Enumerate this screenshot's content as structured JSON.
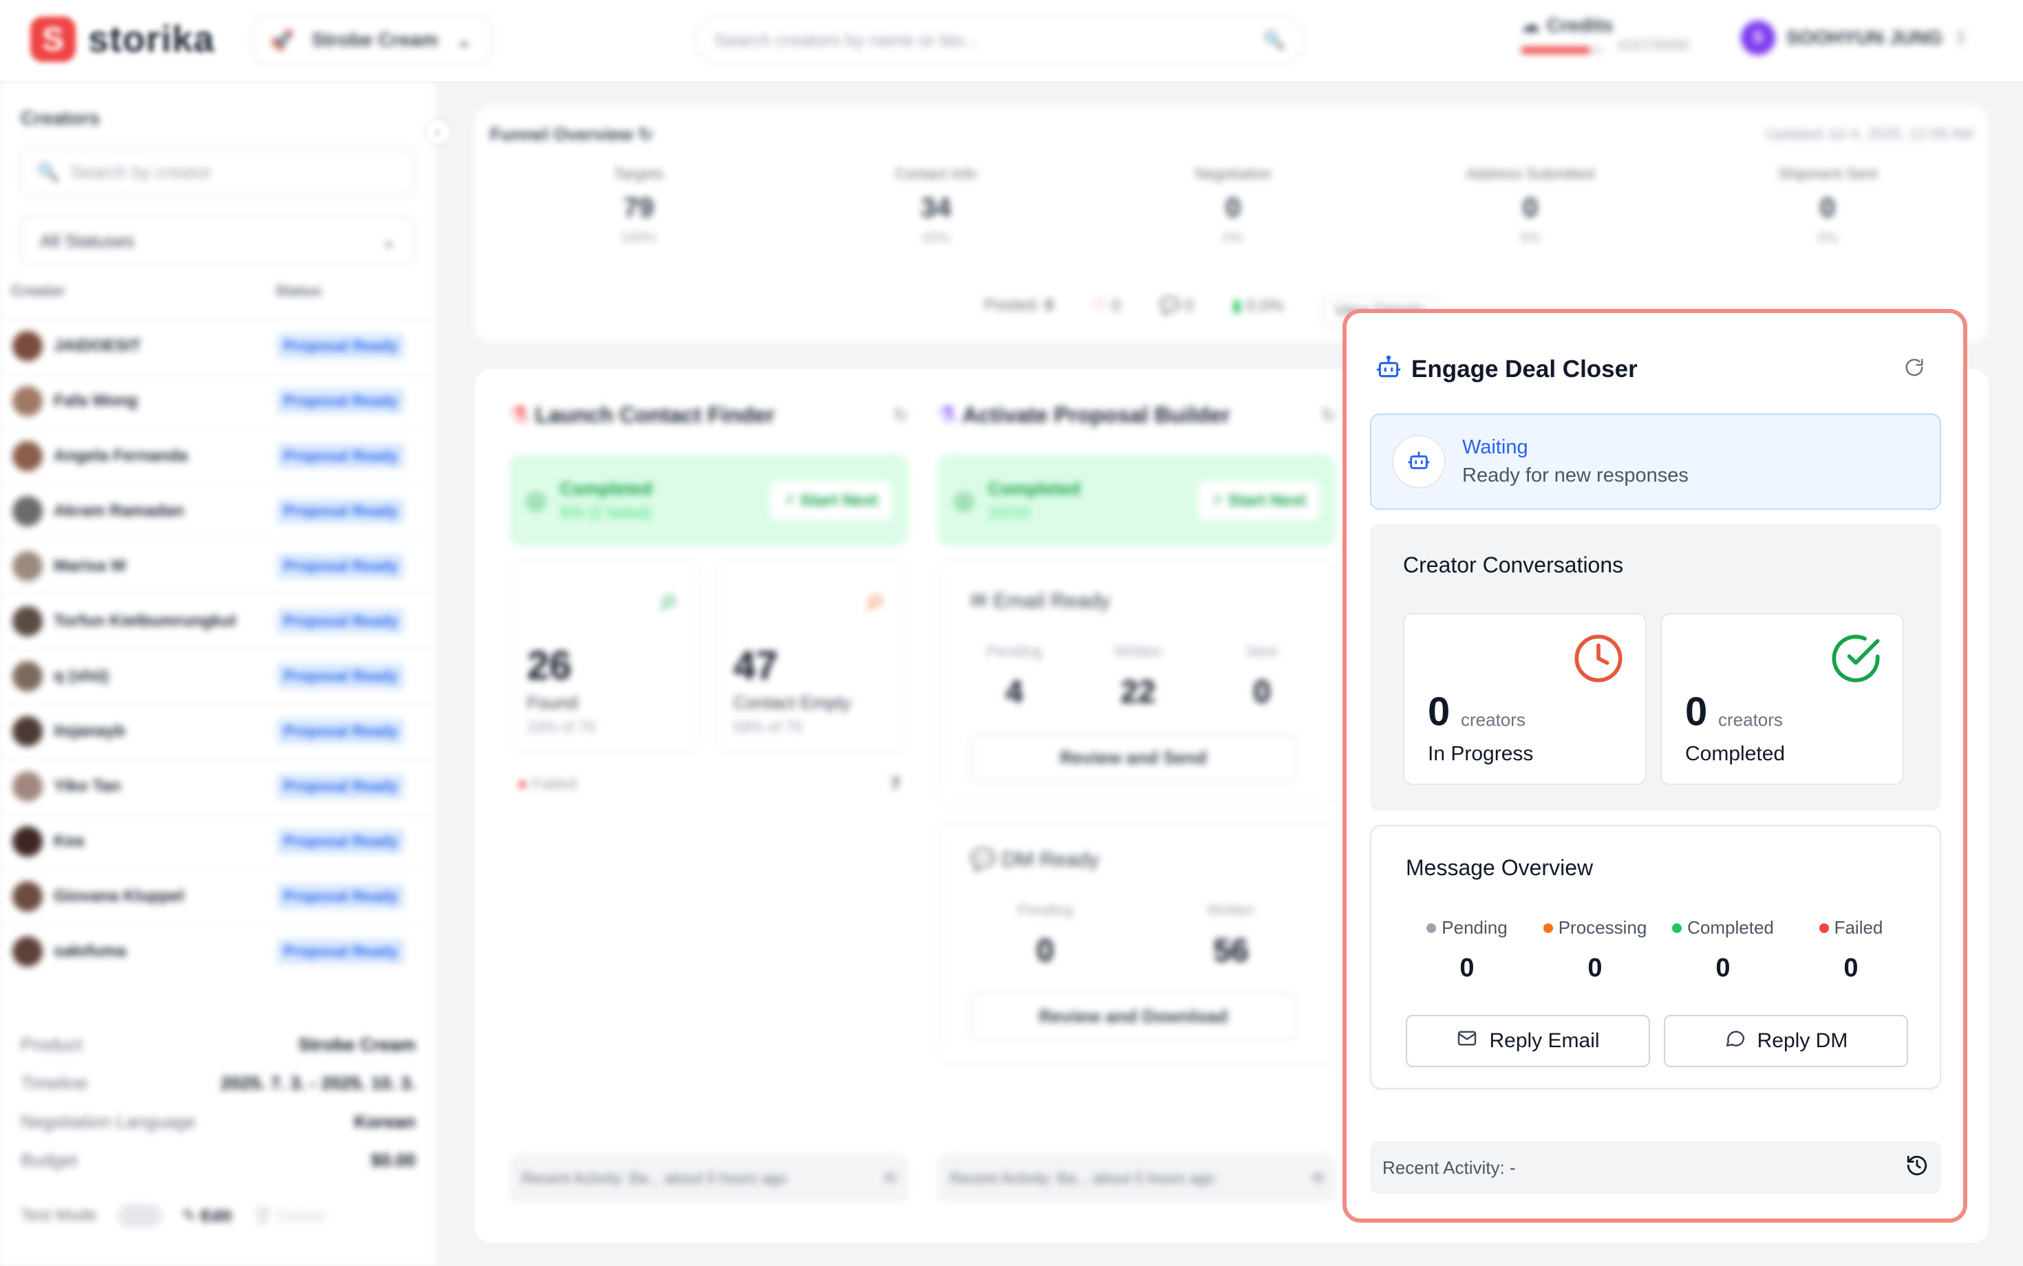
{
  "header": {
    "logo_text": "storika",
    "logo_letter": "S",
    "product_selected": "Strobe Cream",
    "search_placeholder": "Search creators by name or bio...",
    "credits_label": "Credits",
    "credits_used_fraction": 0.83,
    "credits_count": "4157/5000",
    "user_initial": "S",
    "user_name": "SOOHYUN JUNG"
  },
  "sidebar": {
    "title": "Creators",
    "search_placeholder": "Search by creator",
    "status_filter": "All Statuses",
    "col_creator": "Creator",
    "col_status": "Status",
    "creators": [
      {
        "name": "JAIDOESIT",
        "status": "Proposal Ready"
      },
      {
        "name": "Fafa Wong",
        "status": "Proposal Ready"
      },
      {
        "name": "Angela Fernanda",
        "status": "Proposal Ready"
      },
      {
        "name": "Akram Ramadan",
        "status": "Proposal Ready"
      },
      {
        "name": "Marisa W",
        "status": "Proposal Ready"
      },
      {
        "name": "Torfun Kietbumrungkul",
        "status": "Proposal Ready"
      },
      {
        "name": "q (shū)",
        "status": "Proposal Ready"
      },
      {
        "name": "itsjanayb",
        "status": "Proposal Ready"
      },
      {
        "name": "Yiko Tan",
        "status": "Proposal Ready"
      },
      {
        "name": "Kea",
        "status": "Proposal Ready"
      },
      {
        "name": "Giovana Kluppel",
        "status": "Proposal Ready"
      },
      {
        "name": "sałofuma",
        "status": "Proposal Ready"
      }
    ],
    "info": {
      "product_label": "Product",
      "product_value": "Strobe Cream",
      "timeline_label": "Timeline",
      "timeline_value": "2025. 7. 3. - 2025. 10. 3.",
      "language_label": "Negotiation Language",
      "language_value": "Korean",
      "budget_label": "Budget",
      "budget_value": "$0.00"
    },
    "test_mode_label": "Test Mode",
    "edit_label": "Edit",
    "delete_label": "Delete"
  },
  "funnel": {
    "title": "Funnel Overview",
    "updated": "Updated Jul 4, 2025, 12:09 AM",
    "stats": [
      {
        "label": "Targets",
        "value": "79",
        "pct": "100%"
      },
      {
        "label": "Contact Info",
        "value": "34",
        "pct": "43%"
      },
      {
        "label": "Negotiation",
        "value": "0",
        "pct": "0%"
      },
      {
        "label": "Address Submitted",
        "value": "0",
        "pct": "0%"
      },
      {
        "label": "Shipment Sent",
        "value": "0",
        "pct": "0%"
      }
    ],
    "posted_label": "Posted:",
    "posted_value": "0",
    "likes": "0",
    "comments": "0",
    "engagement": "0.0%",
    "view_details": "View Details"
  },
  "contact_finder": {
    "title": "Launch Contact Finder",
    "status": "Completed",
    "detail": "9/9 (2 failed)",
    "start_next": "Start Next",
    "found_value": "26",
    "found_label": "Found",
    "found_pct": "33% of 79",
    "empty_value": "47",
    "empty_label": "Contact Empty",
    "empty_pct": "59% of 79",
    "failed_label": "Failed",
    "failed_value": "7",
    "recent": "Recent Activity: Ba...",
    "recent_time": "about 5 hours ago"
  },
  "proposal_builder": {
    "title": "Activate Proposal Builder",
    "status": "Completed",
    "detail": "10/10",
    "start_next": "Start Next",
    "email_title": "Email Ready",
    "email_pending_label": "Pending",
    "email_pending": "4",
    "email_written_label": "Written",
    "email_written": "22",
    "email_sent_label": "Sent",
    "email_sent": "0",
    "email_button": "Review and Send",
    "dm_title": "DM Ready",
    "dm_pending_label": "Pending",
    "dm_pending": "0",
    "dm_written_label": "Written",
    "dm_written": "56",
    "dm_button": "Review and Download",
    "recent": "Recent Activity: Ba...",
    "recent_time": "about 5 hours ago"
  },
  "deal_closer": {
    "title": "Engage Deal Closer",
    "waiting_title": "Waiting",
    "waiting_sub": "Ready for new responses",
    "conversations_title": "Creator Conversations",
    "in_progress_value": "0",
    "in_progress_unit": "creators",
    "in_progress_label": "In Progress",
    "completed_value": "0",
    "completed_unit": "creators",
    "completed_label": "Completed",
    "message_title": "Message Overview",
    "pending_label": "Pending",
    "pending_value": "0",
    "processing_label": "Processing",
    "processing_value": "0",
    "completed_msg_label": "Completed",
    "completed_msg_value": "0",
    "failed_label": "Failed",
    "failed_value": "0",
    "reply_email": "Reply Email",
    "reply_dm": "Reply DM",
    "recent_activity": "Recent Activity: -"
  },
  "colors": {
    "accent_red": "#ef4444",
    "highlight_border": "#f28b82",
    "waiting_blue": "#2563eb",
    "progress_orange": "#e45a3b",
    "completed_green": "#16a34a"
  }
}
